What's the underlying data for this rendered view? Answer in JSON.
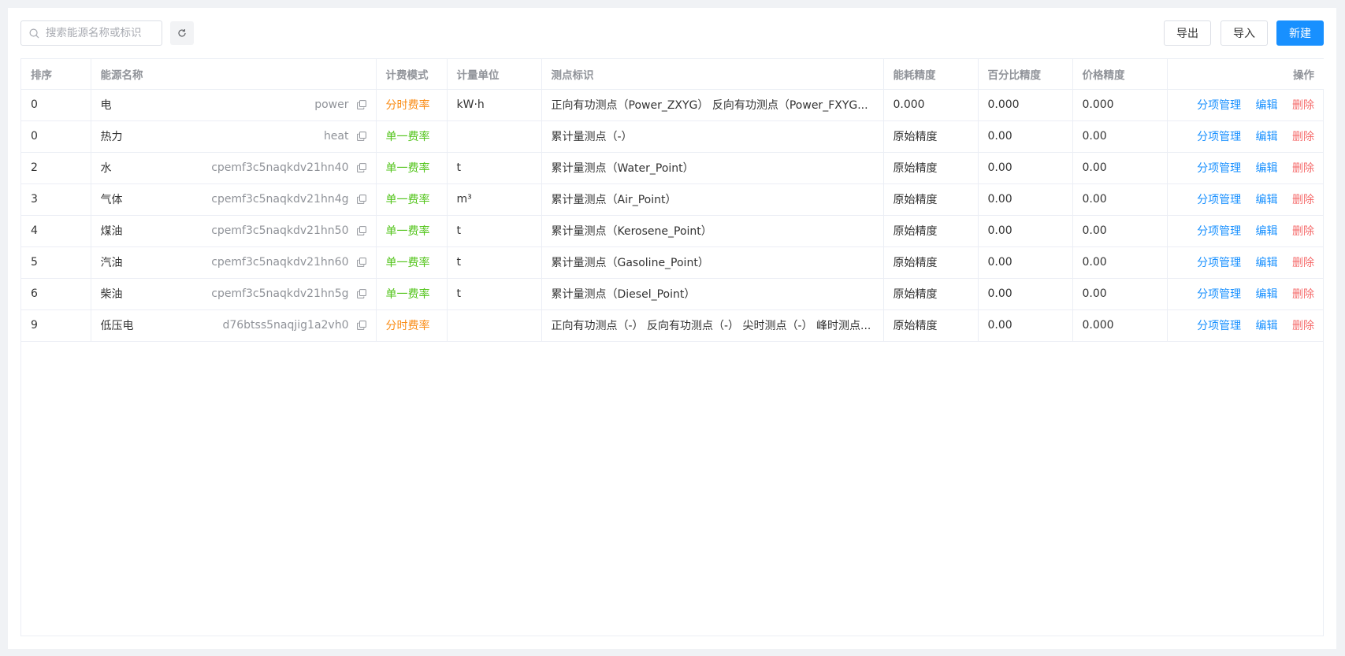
{
  "toolbar": {
    "search_placeholder": "搜索能源名称或标识",
    "export_label": "导出",
    "import_label": "导入",
    "new_label": "新建"
  },
  "table": {
    "headers": {
      "order": "排序",
      "name": "能源名称",
      "mode": "计费模式",
      "unit": "计量单位",
      "points": "测点标识",
      "energy_precision": "能耗精度",
      "percent_precision": "百分比精度",
      "price_precision": "价格精度",
      "ops": "操作"
    },
    "ops": {
      "manage": "分项管理",
      "edit": "编辑",
      "delete": "删除"
    },
    "rows": [
      {
        "order": "0",
        "name": "电",
        "code": "power",
        "mode": "分时费率",
        "mode_type": "tou",
        "unit": "kW·h",
        "points": "正向有功测点（Power_ZXYG） 反向有功测点（Power_FXYG...",
        "energy_precision": "0.000",
        "percent_precision": "0.000",
        "price_precision": "0.000"
      },
      {
        "order": "0",
        "name": "热力",
        "code": "heat",
        "mode": "单一费率",
        "mode_type": "single",
        "unit": "",
        "points": "累计量测点（-）",
        "energy_precision": "原始精度",
        "percent_precision": "0.00",
        "price_precision": "0.00"
      },
      {
        "order": "2",
        "name": "水",
        "code": "cpemf3c5naqkdv21hn40",
        "mode": "单一费率",
        "mode_type": "single",
        "unit": "t",
        "points": "累计量测点（Water_Point）",
        "energy_precision": "原始精度",
        "percent_precision": "0.00",
        "price_precision": "0.00"
      },
      {
        "order": "3",
        "name": "气体",
        "code": "cpemf3c5naqkdv21hn4g",
        "mode": "单一费率",
        "mode_type": "single",
        "unit": "m³",
        "points": "累计量测点（Air_Point）",
        "energy_precision": "原始精度",
        "percent_precision": "0.00",
        "price_precision": "0.00"
      },
      {
        "order": "4",
        "name": "煤油",
        "code": "cpemf3c5naqkdv21hn50",
        "mode": "单一费率",
        "mode_type": "single",
        "unit": "t",
        "points": "累计量测点（Kerosene_Point）",
        "energy_precision": "原始精度",
        "percent_precision": "0.00",
        "price_precision": "0.00"
      },
      {
        "order": "5",
        "name": "汽油",
        "code": "cpemf3c5naqkdv21hn60",
        "mode": "单一费率",
        "mode_type": "single",
        "unit": "t",
        "points": "累计量测点（Gasoline_Point）",
        "energy_precision": "原始精度",
        "percent_precision": "0.00",
        "price_precision": "0.00"
      },
      {
        "order": "6",
        "name": "柴油",
        "code": "cpemf3c5naqkdv21hn5g",
        "mode": "单一费率",
        "mode_type": "single",
        "unit": "t",
        "points": "累计量测点（Diesel_Point）",
        "energy_precision": "原始精度",
        "percent_precision": "0.00",
        "price_precision": "0.00"
      },
      {
        "order": "9",
        "name": "低压电",
        "code": "d76btss5naqjig1a2vh0",
        "mode": "分时费率",
        "mode_type": "tou",
        "unit": "",
        "points": "正向有功测点（-） 反向有功测点（-） 尖时测点（-） 峰时测点...",
        "energy_precision": "原始精度",
        "percent_precision": "0.00",
        "price_precision": "0.000"
      }
    ]
  },
  "colors": {
    "primary": "#1890ff",
    "danger": "#f56c6c",
    "tou": "#fa8c16",
    "single": "#52c41a"
  },
  "icons": [
    "search-icon",
    "refresh-icon",
    "copy-icon"
  ]
}
